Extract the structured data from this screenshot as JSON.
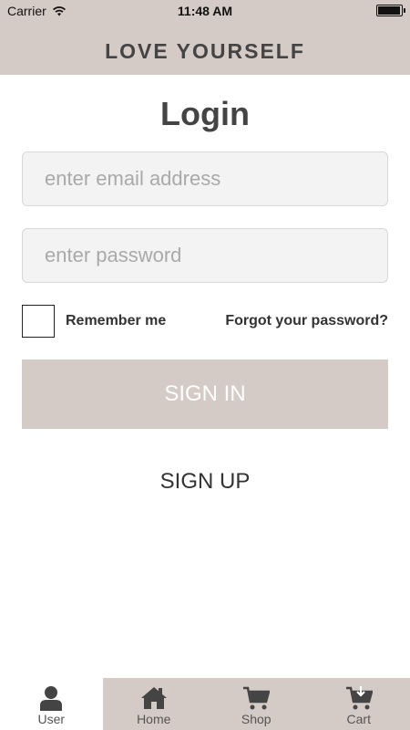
{
  "status_bar": {
    "carrier": "Carrier",
    "time": "11:48 AM",
    "battery_level": 0.95
  },
  "header": {
    "title": "LOVE YOURSELF"
  },
  "login": {
    "title": "Login",
    "email_placeholder": "enter email address",
    "email_value": "",
    "password_placeholder": "enter password",
    "password_value": "",
    "remember_label": "Remember me",
    "remember_checked": false,
    "forgot_label": "Forgot your password?",
    "signin_label": "SIGN IN",
    "signup_label": "SIGN UP"
  },
  "tabs": [
    {
      "label": "User",
      "icon": "user-icon",
      "active": true
    },
    {
      "label": "Home",
      "icon": "home-icon",
      "active": false
    },
    {
      "label": "Shop",
      "icon": "cart-icon",
      "active": false
    },
    {
      "label": "Cart",
      "icon": "cart-download-icon",
      "active": false
    }
  ],
  "colors": {
    "accent": "#d4cac6",
    "text": "#444444",
    "field_bg": "#f3f3f3"
  }
}
